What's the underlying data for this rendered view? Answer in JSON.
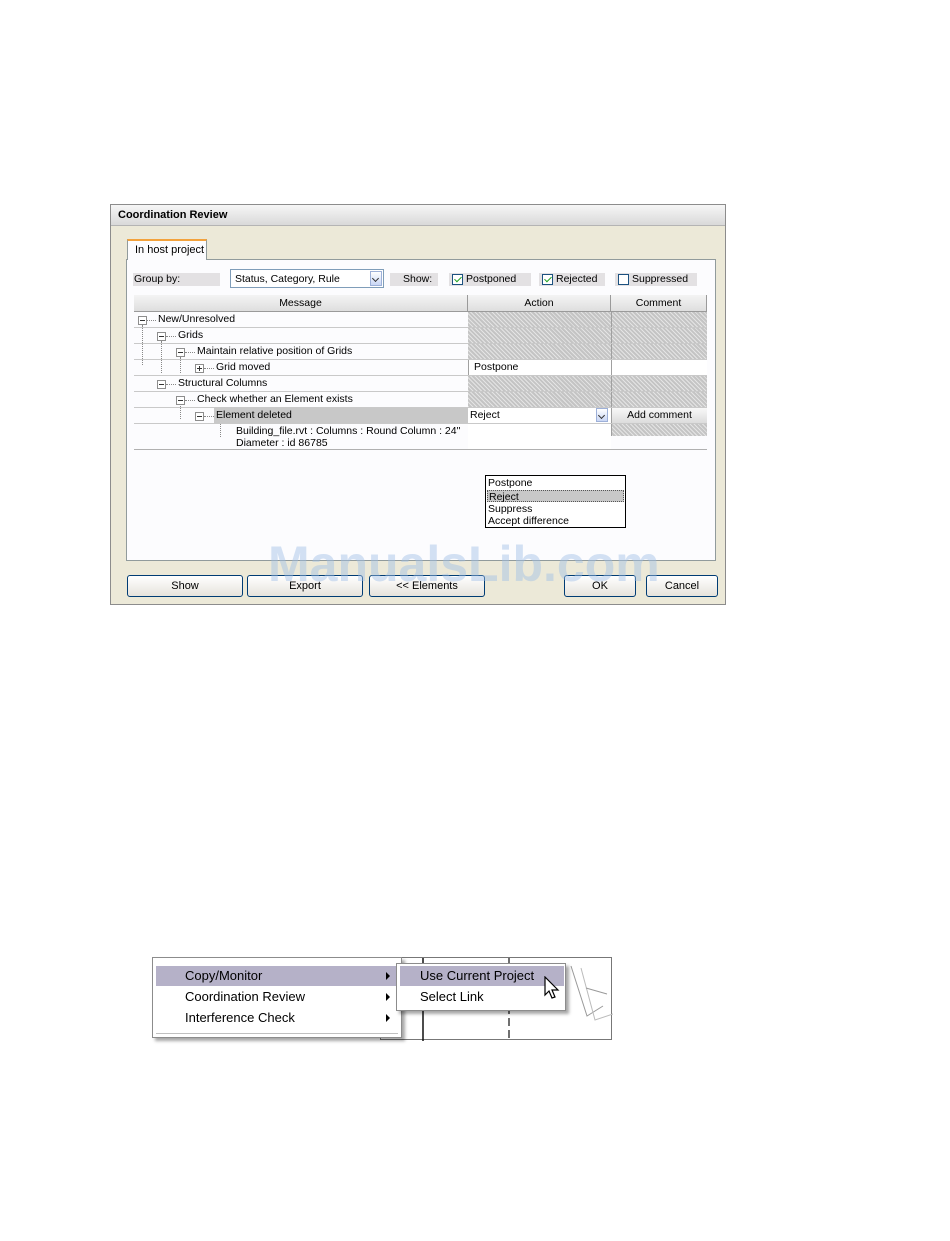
{
  "dialog": {
    "title": "Coordination Review",
    "tab_label": "In host project",
    "group_by": {
      "label": "Group by:",
      "value": "Status, Category, Rule"
    },
    "show": {
      "label": "Show:",
      "postponed": {
        "label": "Postponed",
        "checked": true
      },
      "rejected": {
        "label": "Rejected",
        "checked": true
      },
      "suppressed": {
        "label": "Suppressed",
        "checked": false
      }
    },
    "columns": {
      "message": "Message",
      "action": "Action",
      "comment": "Comment"
    },
    "rows": {
      "r1": "New/Unresolved",
      "r2": "Grids",
      "r3": "Maintain relative position of Grids",
      "r4": {
        "label": "Grid moved",
        "action": "Postpone"
      },
      "r5": "Structural Columns",
      "r6": "Check whether an Element exists",
      "r7": {
        "label": "Element deleted",
        "action": "Reject",
        "comment_button": "Add comment"
      },
      "r8": {
        "line1": "Building_file.rvt : Columns : Round Column : 24\"",
        "line2": "Diameter : id 86785"
      }
    },
    "action_options": [
      "Postpone",
      "Reject",
      "Suppress",
      "Accept difference"
    ],
    "buttons": {
      "show": "Show",
      "export": "Export",
      "elements": "<< Elements",
      "ok": "OK",
      "cancel": "Cancel"
    }
  },
  "watermark": "ManualsLib.com",
  "context_menu": {
    "items": [
      "Copy/Monitor",
      "Coordination Review",
      "Interference Check"
    ],
    "submenu": [
      "Use Current Project",
      "Select Link"
    ]
  },
  "colors": {
    "highlight": "#b5b1c8",
    "tab_accent": "#f3a23c",
    "checkmark": "#21a121"
  }
}
